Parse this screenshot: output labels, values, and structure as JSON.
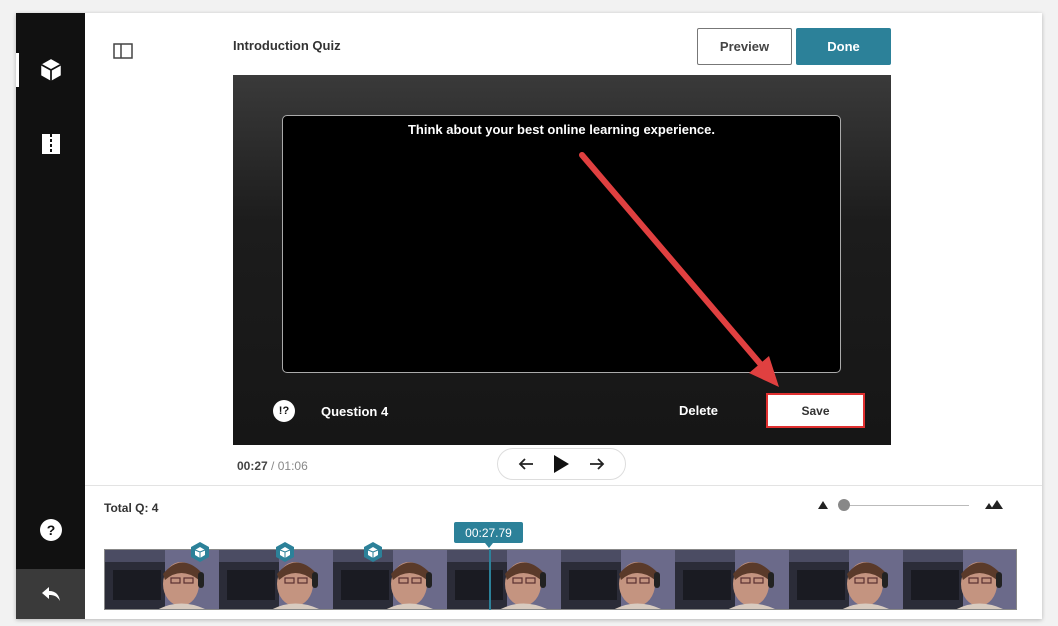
{
  "header": {
    "title": "Introduction Quiz",
    "preview_label": "Preview",
    "done_label": "Done"
  },
  "player": {
    "question_text": "Think about your best online learning experience.",
    "question_icon": "!?",
    "question_label": "Question 4",
    "delete_label": "Delete",
    "save_label": "Save"
  },
  "playback": {
    "current_time": "00:27",
    "separator": "/",
    "duration": "01:06"
  },
  "timeline": {
    "total_label": "Total Q: 4",
    "playhead_time": "00:27.79",
    "zoom_level": 0
  },
  "icons": {
    "sidebar": [
      "cube-icon",
      "book-icon",
      "help-icon",
      "back-icon"
    ],
    "controls": [
      "arrow-left-icon",
      "play-icon",
      "arrow-right-icon"
    ],
    "marker": "cube-marker-icon"
  },
  "colors": {
    "accent": "#2c8199",
    "sidebar": "#111111",
    "highlight": "#e03030"
  }
}
